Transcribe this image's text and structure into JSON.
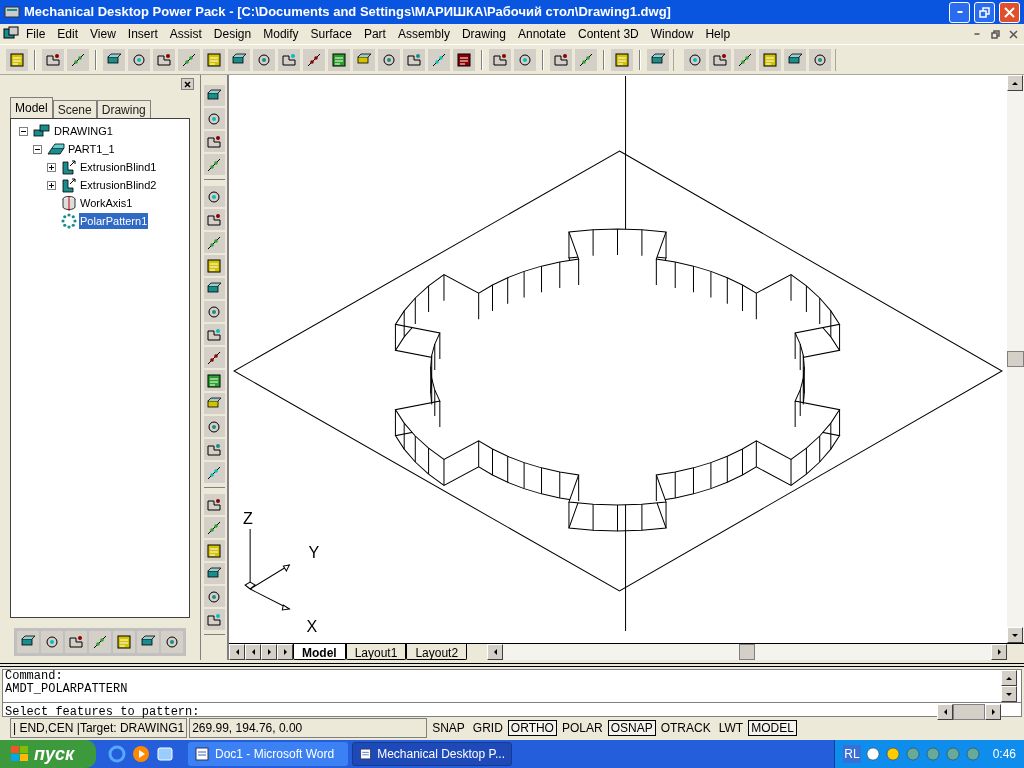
{
  "window": {
    "title": "Mechanical Desktop Power Pack - [C:\\Documents and Settings\\МАРИШКА\\Рабочий стол\\Drawing1.dwg]"
  },
  "menu": [
    "File",
    "Edit",
    "View",
    "Insert",
    "Assist",
    "Design",
    "Modify",
    "Surface",
    "Part",
    "Assembly",
    "Drawing",
    "Annotate",
    "Content 3D",
    "Window",
    "Help"
  ],
  "browser": {
    "tabs": [
      {
        "label": "Model",
        "selected": true
      },
      {
        "label": "Scene",
        "selected": false
      },
      {
        "label": "Drawing",
        "selected": false
      }
    ],
    "tree": [
      {
        "label": "DRAWING1",
        "kind": "assembly",
        "expanded": true,
        "selected": false,
        "children": [
          {
            "label": "PART1_1",
            "kind": "part",
            "expanded": true,
            "selected": false,
            "children": [
              {
                "label": "ExtrusionBlind1",
                "kind": "extrusion",
                "expanded": false,
                "selected": false
              },
              {
                "label": "ExtrusionBlind2",
                "kind": "extrusion",
                "expanded": false,
                "selected": false
              },
              {
                "label": "WorkAxis1",
                "kind": "axis",
                "selected": false
              },
              {
                "label": "PolarPattern1",
                "kind": "pattern",
                "selected": true
              }
            ]
          }
        ]
      }
    ]
  },
  "viewport": {
    "axis_labels": [
      "Z",
      "Y",
      "X"
    ]
  },
  "layout_tabs": [
    {
      "label": "Model",
      "selected": true
    },
    {
      "label": "Layout1",
      "selected": false
    },
    {
      "label": "Layout2",
      "selected": false
    }
  ],
  "command_lines": [
    "Command:",
    "AMDT_POLARPATTERN"
  ],
  "command_prompt": "Select features to pattern:",
  "status_bar": {
    "snap_info": "| END,CEN |Target: DRAWING1",
    "coordinates": "269.99, 194.76, 0.00",
    "toggles": [
      {
        "label": "SNAP",
        "on": false
      },
      {
        "label": "GRID",
        "on": false
      },
      {
        "label": "ORTHO",
        "on": true
      },
      {
        "label": "POLAR",
        "on": false
      },
      {
        "label": "OSNAP",
        "on": true
      },
      {
        "label": "OTRACK",
        "on": false
      },
      {
        "label": "LWT",
        "on": false
      },
      {
        "label": "MODEL",
        "on": true
      }
    ]
  },
  "taskbar": {
    "start": "пуск",
    "tasks": [
      {
        "label": "Doc1 - Microsoft Word",
        "selected": false
      },
      {
        "label": "Mechanical Desktop P...",
        "selected": true
      }
    ],
    "language": "RL",
    "clock": "0:46"
  }
}
